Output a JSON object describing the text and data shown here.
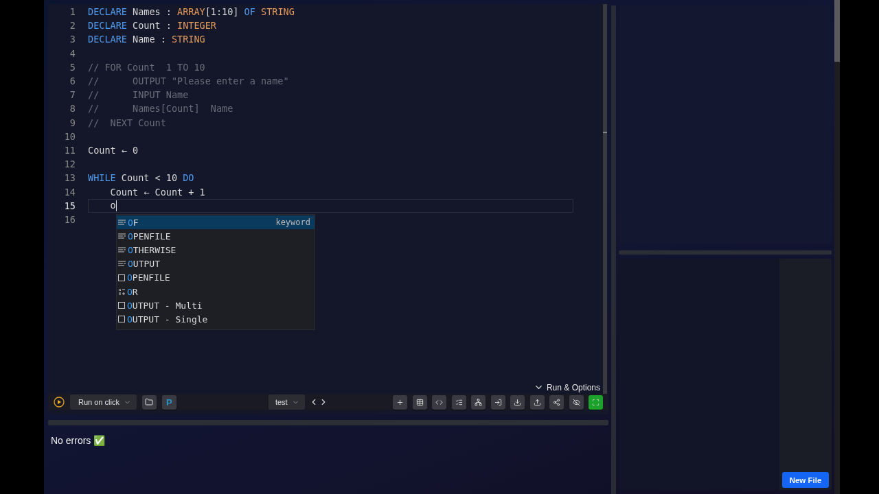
{
  "editor": {
    "lines": [
      {
        "number": "1",
        "current": false,
        "tokens": [
          {
            "kind": "keyword",
            "text": "DECLARE"
          },
          {
            "kind": "plain",
            "text": " Names : "
          },
          {
            "kind": "type",
            "text": "ARRAY"
          },
          {
            "kind": "plain",
            "text": "[1:10] "
          },
          {
            "kind": "keyword",
            "text": "OF"
          },
          {
            "kind": "type",
            "text": " STRING"
          }
        ]
      },
      {
        "number": "2",
        "current": false,
        "tokens": [
          {
            "kind": "keyword",
            "text": "DECLARE"
          },
          {
            "kind": "plain",
            "text": " Count : "
          },
          {
            "kind": "type",
            "text": "INTEGER"
          }
        ]
      },
      {
        "number": "3",
        "current": false,
        "tokens": [
          {
            "kind": "keyword",
            "text": "DECLARE"
          },
          {
            "kind": "plain",
            "text": " Name : "
          },
          {
            "kind": "type",
            "text": "STRING"
          }
        ]
      },
      {
        "number": "4",
        "current": false
      },
      {
        "number": "5",
        "current": false,
        "tokens": [
          {
            "kind": "comment",
            "text": "// FOR Count  1 TO 10"
          }
        ]
      },
      {
        "number": "6",
        "current": false,
        "tokens": [
          {
            "kind": "comment",
            "text": "//      OUTPUT \"Please enter a name\""
          }
        ]
      },
      {
        "number": "7",
        "current": false,
        "tokens": [
          {
            "kind": "comment",
            "text": "//      INPUT Name"
          }
        ]
      },
      {
        "number": "8",
        "current": false,
        "tokens": [
          {
            "kind": "comment",
            "text": "//      Names[Count]  Name"
          }
        ]
      },
      {
        "number": "9",
        "current": false,
        "tokens": [
          {
            "kind": "comment",
            "text": "//  NEXT Count"
          }
        ]
      },
      {
        "number": "10",
        "current": false
      },
      {
        "number": "11",
        "current": false,
        "tokens": [
          {
            "kind": "plain",
            "text": "Count ← 0"
          }
        ]
      },
      {
        "number": "12",
        "current": false
      },
      {
        "number": "13",
        "current": false,
        "tokens": [
          {
            "kind": "keyword",
            "text": "WHILE"
          },
          {
            "kind": "plain",
            "text": " Count < 10 "
          },
          {
            "kind": "keyword",
            "text": "DO"
          }
        ]
      },
      {
        "number": "14",
        "current": false,
        "tokens": [
          {
            "kind": "plain",
            "text": "    Count ← Count + 1"
          }
        ]
      },
      {
        "number": "15",
        "current": true,
        "tokens": [
          {
            "kind": "plain",
            "text": "    o"
          }
        ]
      },
      {
        "number": "16",
        "current": false
      }
    ],
    "suggestions": [
      {
        "kind": "keyword",
        "matched": "O",
        "rest": "F",
        "detail": "keyword",
        "selected": true
      },
      {
        "kind": "keyword",
        "matched": "O",
        "rest": "PENFILE",
        "selected": false
      },
      {
        "kind": "keyword",
        "matched": "O",
        "rest": "THERWISE",
        "selected": false
      },
      {
        "kind": "keyword",
        "matched": "O",
        "rest": "UTPUT",
        "selected": false
      },
      {
        "kind": "snippet",
        "matched": "O",
        "rest": "PENFILE",
        "selected": false
      },
      {
        "kind": "operator",
        "matched": "O",
        "rest": "R",
        "selected": false
      },
      {
        "kind": "snippet",
        "matched": "O",
        "rest": "UTPUT - Multi",
        "selected": false
      },
      {
        "kind": "snippet",
        "matched": "O",
        "rest": "UTPUT - Single",
        "selected": false
      }
    ]
  },
  "run_options": {
    "label": "Run & Options",
    "expanded": true
  },
  "toolbar": {
    "run_mode": "Run on click",
    "language_badge": "P",
    "file": "test",
    "fullscreen": {
      "on": true
    }
  },
  "output": {
    "message": "No errors",
    "emoji": "✅"
  },
  "files": {
    "new_file_button": "New File"
  }
}
